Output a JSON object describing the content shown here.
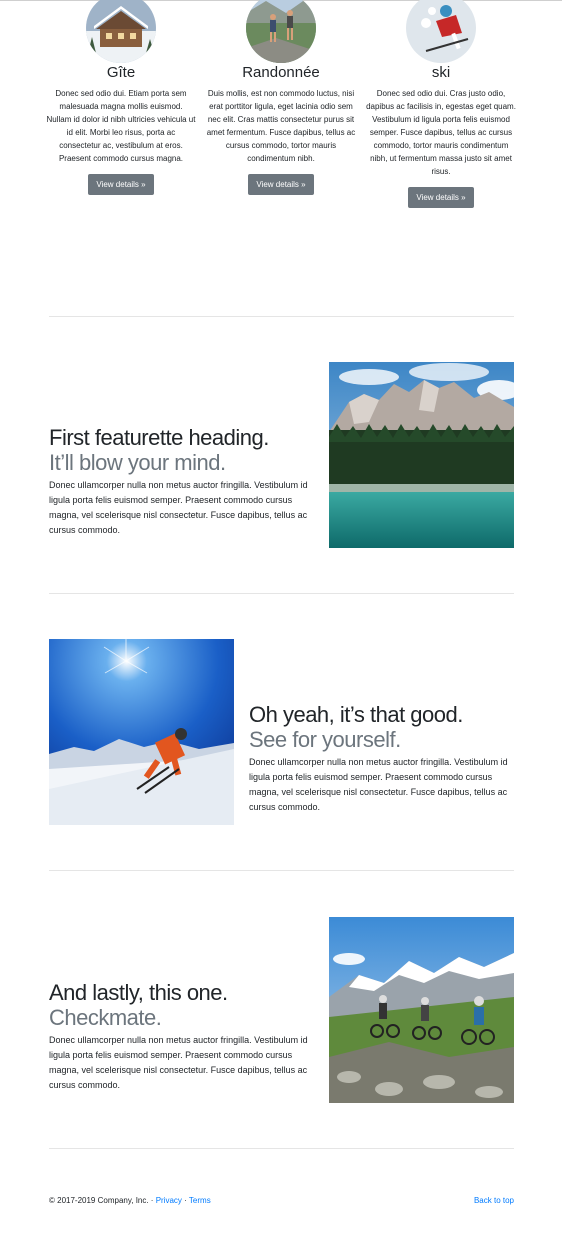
{
  "marketing": [
    {
      "heading": "Gîte",
      "text": "Donec sed odio dui. Etiam porta sem malesuada magna mollis euismod. Nullam id dolor id nibh ultricies vehicula ut id elit. Morbi leo risus, porta ac consectetur ac, vestibulum at eros. Praesent commodo cursus magna.",
      "button": "View details »"
    },
    {
      "heading": "Randonnée",
      "text": "Duis mollis, est non commodo luctus, nisi erat porttitor ligula, eget lacinia odio sem nec elit. Cras mattis consectetur purus sit amet fermentum. Fusce dapibus, tellus ac cursus commodo, tortor mauris condimentum nibh.",
      "button": "View details »"
    },
    {
      "heading": "ski",
      "text": "Donec sed odio dui. Cras justo odio, dapibus ac facilisis in, egestas eget quam. Vestibulum id ligula porta felis euismod semper. Fusce dapibus, tellus ac cursus commodo, tortor mauris condimentum nibh, ut fermentum massa justo sit amet risus.",
      "button": "View details »"
    }
  ],
  "featurettes": [
    {
      "heading": "First featurette heading.",
      "muted": "It’ll blow your mind.",
      "text": "Donec ullamcorper nulla non metus auctor fringilla. Vestibulum id ligula porta felis euismod semper. Praesent commodo cursus magna, vel scelerisque nisl consectetur. Fusce dapibus, tellus ac cursus commodo."
    },
    {
      "heading": "Oh yeah, it’s that good.",
      "muted": "See for yourself.",
      "text": "Donec ullamcorper nulla non metus auctor fringilla. Vestibulum id ligula porta felis euismod semper. Praesent commodo cursus magna, vel scelerisque nisl consectetur. Fusce dapibus, tellus ac cursus commodo."
    },
    {
      "heading": "And lastly, this one.",
      "muted": "Checkmate.",
      "text": "Donec ullamcorper nulla non metus auctor fringilla. Vestibulum id ligula porta felis euismod semper. Praesent commodo cursus magna, vel scelerisque nisl consectetur. Fusce dapibus, tellus ac cursus commodo."
    }
  ],
  "footer": {
    "copyright": "© 2017-2019 Company, Inc. ·",
    "privacy": "Privacy",
    "dot": "·",
    "terms": "Terms",
    "back_to_top": "Back to top"
  },
  "colors": {
    "link": "#007bff",
    "button_bg": "#6c757d",
    "muted": "#6c757d"
  }
}
